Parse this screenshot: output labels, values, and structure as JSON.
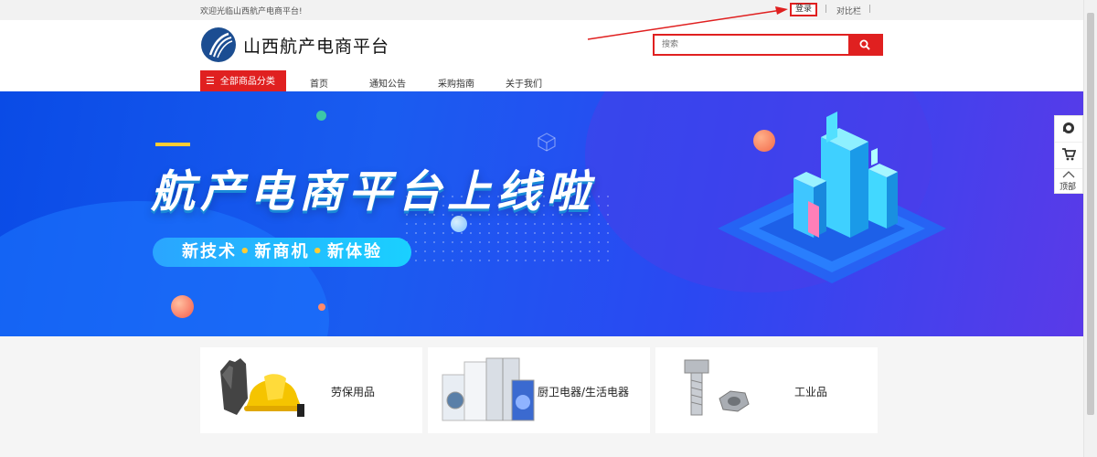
{
  "topbar": {
    "welcome": "欢迎光临山西航产电商平台!",
    "login": "登录",
    "separator": "|",
    "compare": "对比栏"
  },
  "header": {
    "logo_text": "山西航产电商平台",
    "search_placeholder": "搜索"
  },
  "nav": {
    "all_categories": "全部商品分类",
    "links": [
      "首页",
      "通知公告",
      "采购指南",
      "关于我们"
    ]
  },
  "banner": {
    "title": "航产电商平台上线啦",
    "pill_items": [
      "新技术",
      "新商机",
      "新体验"
    ],
    "pill_dot": "•"
  },
  "side_tools": {
    "icons": [
      "customer-service-icon",
      "cart-icon",
      "chevron-up-icon"
    ],
    "top_label": "顶部"
  },
  "categories": [
    {
      "label": "劳保用品",
      "icon": "gloves-helmet-icon"
    },
    {
      "label": "厨卫电器/生活电器",
      "icon": "appliances-icon"
    },
    {
      "label": "工业品",
      "icon": "bolt-nut-icon"
    }
  ],
  "colors": {
    "accent": "#e02020",
    "banner_blue": "#1a5cf0",
    "banner_violet": "#5a3ae8",
    "highlight_yellow": "#ffcc33"
  }
}
